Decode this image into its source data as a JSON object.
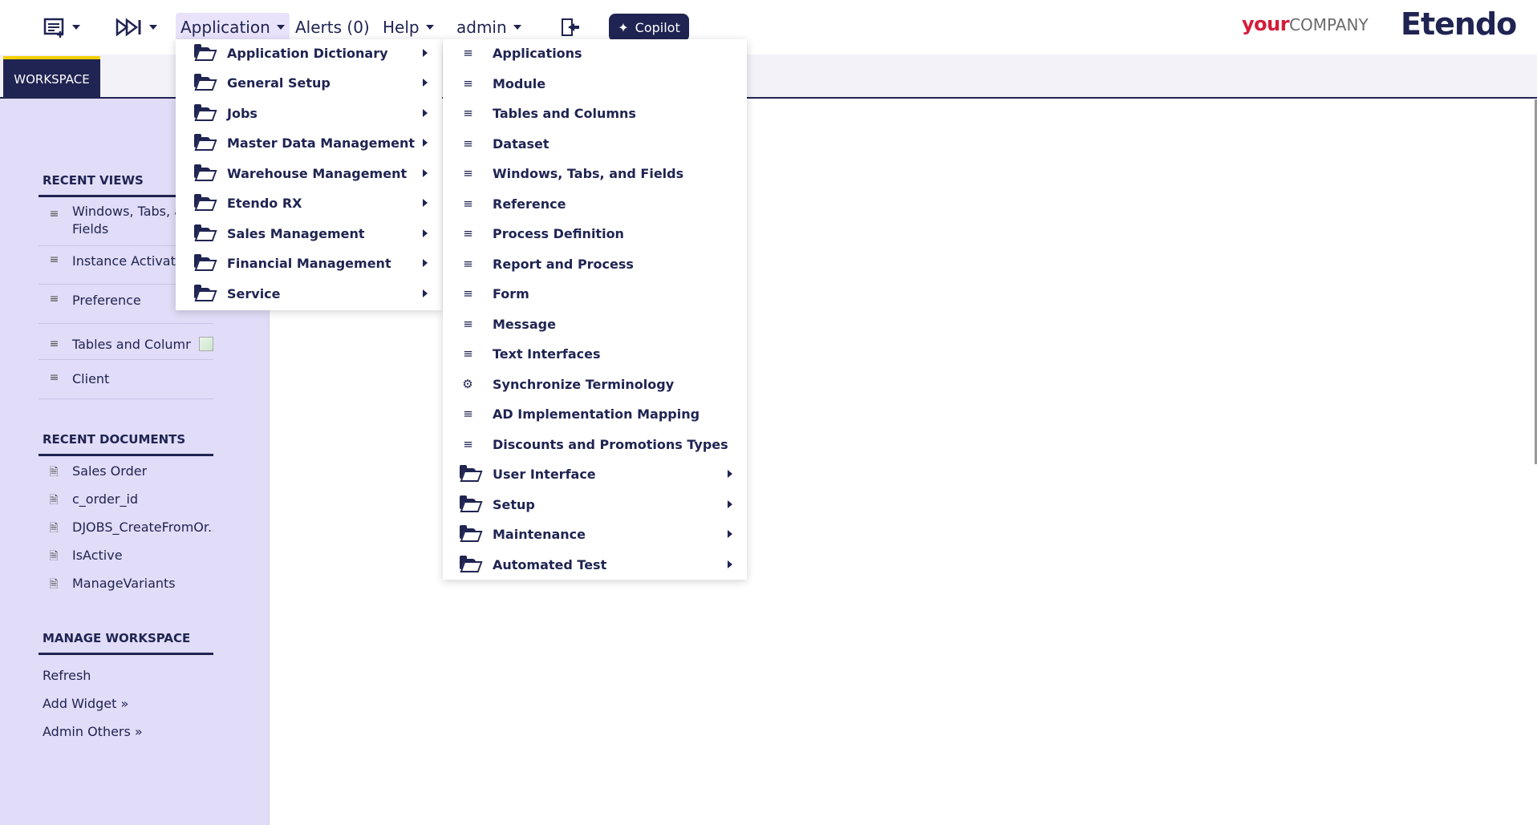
{
  "topbar": {
    "app_menu": "Application",
    "alerts": "Alerts (0)",
    "help": "Help",
    "user": "admin",
    "copilot": "Copilot",
    "logo_your": "your",
    "logo_company": "COMPANY",
    "logo_etendo": "Etendo"
  },
  "workspace_tab": "WORKSPACE",
  "sidebar": {
    "recent_views_title": "RECENT VIEWS",
    "recent_views": [
      {
        "label": "Windows, Tabs, and",
        "label2": "Fields"
      },
      {
        "label": "Instance Activation"
      },
      {
        "label": "Preference"
      },
      {
        "label": "Tables and Columns"
      },
      {
        "label": "Client"
      }
    ],
    "recent_docs_title": "RECENT DOCUMENTS",
    "recent_docs": [
      {
        "label": "Sales Order"
      },
      {
        "label": "c_order_id"
      },
      {
        "label": "DJOBS_CreateFromOr..."
      },
      {
        "label": "IsActive"
      },
      {
        "label": "ManageVariants"
      }
    ],
    "manage_title": "MANAGE WORKSPACE",
    "manage_links": [
      {
        "label": "Refresh"
      },
      {
        "label": "Add Widget »"
      },
      {
        "label": "Admin Others »"
      }
    ]
  },
  "menu_level1": [
    {
      "label": "Application Dictionary",
      "icon": "folder-open-icon"
    },
    {
      "label": "General Setup",
      "icon": "folder-open-icon"
    },
    {
      "label": "Jobs",
      "icon": "folder-open-icon"
    },
    {
      "label": "Master Data Management",
      "icon": "folder-open-icon"
    },
    {
      "label": "Warehouse Management",
      "icon": "folder-open-icon"
    },
    {
      "label": "Etendo RX",
      "icon": "folder-open-icon"
    },
    {
      "label": "Sales Management",
      "icon": "folder-open-icon"
    },
    {
      "label": "Financial Management",
      "icon": "folder-open-icon"
    },
    {
      "label": "Service",
      "icon": "folder-open-icon"
    }
  ],
  "menu_level2": [
    {
      "label": "Applications",
      "icon": "window-icon"
    },
    {
      "label": "Module",
      "icon": "window-icon"
    },
    {
      "label": "Tables and Columns",
      "icon": "window-icon"
    },
    {
      "label": "Dataset",
      "icon": "window-icon"
    },
    {
      "label": "Windows, Tabs, and Fields",
      "icon": "window-icon"
    },
    {
      "label": "Reference",
      "icon": "window-icon"
    },
    {
      "label": "Process Definition",
      "icon": "window-icon"
    },
    {
      "label": "Report and Process",
      "icon": "window-icon"
    },
    {
      "label": "Form",
      "icon": "window-icon"
    },
    {
      "label": "Message",
      "icon": "window-icon"
    },
    {
      "label": "Text Interfaces",
      "icon": "window-icon"
    },
    {
      "label": "Synchronize Terminology",
      "icon": "gear-icon"
    },
    {
      "label": "AD Implementation Mapping",
      "icon": "window-icon"
    },
    {
      "label": "Discounts and Promotions Types",
      "icon": "window-icon"
    },
    {
      "label": "User Interface",
      "icon": "folder-open-icon"
    },
    {
      "label": "Setup",
      "icon": "folder-open-icon"
    },
    {
      "label": "Maintenance",
      "icon": "folder-open-icon"
    },
    {
      "label": "Automated Test",
      "icon": "folder-open-icon"
    }
  ],
  "colors": {
    "primary": "#202452",
    "sidebar_bg": "#e1dcf7",
    "tab_accent": "#f4d000",
    "logo_red": "#d41c3a"
  }
}
